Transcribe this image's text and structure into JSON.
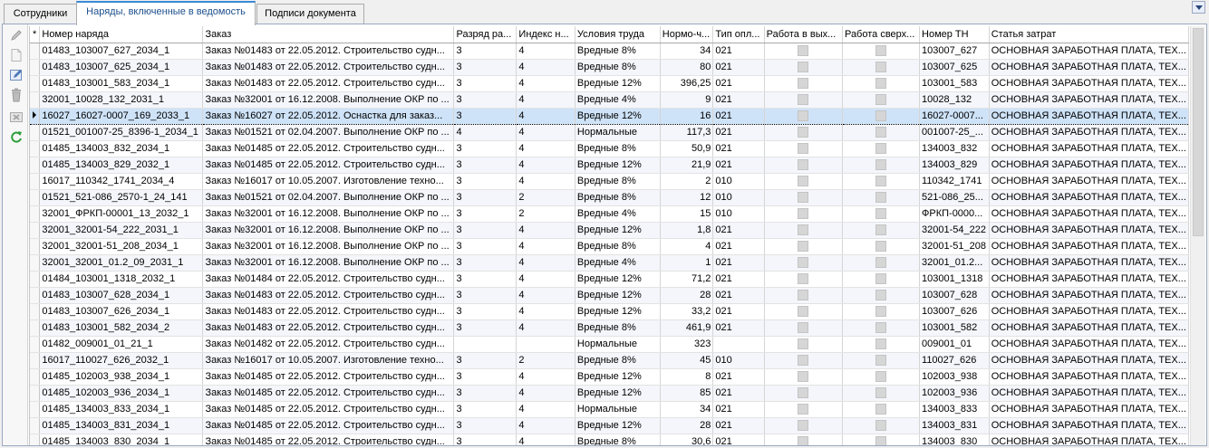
{
  "tabs": [
    {
      "label": "Сотрудники"
    },
    {
      "label": "Наряды, включенные в ведомость"
    },
    {
      "label": "Подписи документа"
    }
  ],
  "icons": [
    "pen-icon",
    "new-document-icon",
    "edit-icon",
    "delete-icon",
    "cancel-icon",
    "refresh-icon"
  ],
  "grid": {
    "header_marker": "*",
    "columns": [
      {
        "label": "Номер наряда"
      },
      {
        "label": "Заказ"
      },
      {
        "label": "Разряд ра..."
      },
      {
        "label": "Индекс н..."
      },
      {
        "label": "Условия труда"
      },
      {
        "label": "Нормо-ч..."
      },
      {
        "label": "Тип опл..."
      },
      {
        "label": "Работа в вых..."
      },
      {
        "label": "Работа сверх..."
      },
      {
        "label": "Номер ТН"
      },
      {
        "label": "Статья затрат"
      }
    ],
    "rows": [
      {
        "c": [
          "01483_103007_627_2034_1",
          "Заказ №01483 от 22.05.2012. Строительство судн...",
          "3",
          "4",
          "Вредные 8%",
          "34",
          "021",
          "103007_627",
          "ОСНОВНАЯ ЗАРАБОТНАЯ ПЛАТА, ТЕХ..."
        ]
      },
      {
        "c": [
          "01483_103007_625_2034_1",
          "Заказ №01483 от 22.05.2012. Строительство судн...",
          "3",
          "4",
          "Вредные 8%",
          "80",
          "021",
          "103007_625",
          "ОСНОВНАЯ ЗАРАБОТНАЯ ПЛАТА, ТЕХ..."
        ]
      },
      {
        "c": [
          "01483_103001_583_2034_1",
          "Заказ №01483 от 22.05.2012. Строительство судн...",
          "3",
          "4",
          "Вредные 12%",
          "396,25",
          "021",
          "103001_583",
          "ОСНОВНАЯ ЗАРАБОТНАЯ ПЛАТА, ТЕХ..."
        ]
      },
      {
        "c": [
          "32001_10028_132_2031_1",
          "Заказ №32001 от 16.12.2008. Выполнение ОКР по ...",
          "3",
          "4",
          "Вредные 4%",
          "9",
          "021",
          "10028_132",
          "ОСНОВНАЯ ЗАРАБОТНАЯ ПЛАТА, ТЕХ..."
        ]
      },
      {
        "c": [
          "16027_16027-0007_169_2033_1",
          "Заказ №16027 от 22.05.2012. Оснастка для заказ...",
          "3",
          "4",
          "Вредные 12%",
          "16",
          "021",
          "16027-0007...",
          "ОСНОВНАЯ ЗАРАБОТНАЯ ПЛАТА, ТЕХ..."
        ],
        "selected": true
      },
      {
        "c": [
          "01521_001007-25_8396-1_2034_1",
          "Заказ №01521 от 02.04.2007. Выполнение ОКР по ...",
          "4",
          "4",
          "Нормальные",
          "117,3",
          "021",
          "001007-25_...",
          "ОСНОВНАЯ ЗАРАБОТНАЯ ПЛАТА, ТЕХ..."
        ]
      },
      {
        "c": [
          "01485_134003_832_2034_1",
          "Заказ №01485 от 22.05.2012. Строительство судн...",
          "3",
          "4",
          "Вредные 8%",
          "50,9",
          "021",
          "134003_832",
          "ОСНОВНАЯ ЗАРАБОТНАЯ ПЛАТА, ТЕХ..."
        ]
      },
      {
        "c": [
          "01485_134003_829_2032_1",
          "Заказ №01485 от 22.05.2012. Строительство судн...",
          "3",
          "4",
          "Вредные 12%",
          "21,9",
          "021",
          "134003_829",
          "ОСНОВНАЯ ЗАРАБОТНАЯ ПЛАТА, ТЕХ..."
        ]
      },
      {
        "c": [
          "16017_110342_1741_2034_4",
          "Заказ №16017 от 10.05.2007. Изготовление техно...",
          "3",
          "4",
          "Вредные 8%",
          "2",
          "010",
          "110342_1741",
          "ОСНОВНАЯ ЗАРАБОТНАЯ ПЛАТА, ТЕХ..."
        ]
      },
      {
        "c": [
          "01521_521-086_2570-1_24_141",
          "Заказ №01521 от 02.04.2007. Выполнение ОКР по ...",
          "3",
          "2",
          "Вредные 8%",
          "12",
          "010",
          "521-086_25...",
          "ОСНОВНАЯ ЗАРАБОТНАЯ ПЛАТА, ТЕХ..."
        ]
      },
      {
        "c": [
          "32001_ФРКП-00001_13_2032_1",
          "Заказ №32001 от 16.12.2008. Выполнение ОКР по ...",
          "3",
          "2",
          "Вредные 4%",
          "15",
          "010",
          "ФРКП-0000...",
          "ОСНОВНАЯ ЗАРАБОТНАЯ ПЛАТА, ТЕХ..."
        ]
      },
      {
        "c": [
          "32001_32001-54_222_2031_1",
          "Заказ №32001 от 16.12.2008. Выполнение ОКР по ...",
          "3",
          "4",
          "Вредные 12%",
          "1,8",
          "021",
          "32001-54_222",
          "ОСНОВНАЯ ЗАРАБОТНАЯ ПЛАТА, ТЕХ..."
        ]
      },
      {
        "c": [
          "32001_32001-51_208_2034_1",
          "Заказ №32001 от 16.12.2008. Выполнение ОКР по ...",
          "3",
          "4",
          "Вредные 8%",
          "4",
          "021",
          "32001-51_208",
          "ОСНОВНАЯ ЗАРАБОТНАЯ ПЛАТА, ТЕХ..."
        ]
      },
      {
        "c": [
          "32001_32001_01.2_09_2031_1",
          "Заказ №32001 от 16.12.2008. Выполнение ОКР по ...",
          "3",
          "4",
          "Вредные 4%",
          "1",
          "021",
          "32001_01.2...",
          "ОСНОВНАЯ ЗАРАБОТНАЯ ПЛАТА, ТЕХ..."
        ]
      },
      {
        "c": [
          "01484_103001_1318_2032_1",
          "Заказ №01484 от 22.05.2012. Строительство судн...",
          "3",
          "4",
          "Вредные 12%",
          "71,2",
          "021",
          "103001_1318",
          "ОСНОВНАЯ ЗАРАБОТНАЯ ПЛАТА, ТЕХ..."
        ]
      },
      {
        "c": [
          "01483_103007_628_2034_1",
          "Заказ №01483 от 22.05.2012. Строительство судн...",
          "3",
          "4",
          "Вредные 12%",
          "28",
          "021",
          "103007_628",
          "ОСНОВНАЯ ЗАРАБОТНАЯ ПЛАТА, ТЕХ..."
        ]
      },
      {
        "c": [
          "01483_103007_626_2034_1",
          "Заказ №01483 от 22.05.2012. Строительство судн...",
          "3",
          "4",
          "Вредные 12%",
          "33,2",
          "021",
          "103007_626",
          "ОСНОВНАЯ ЗАРАБОТНАЯ ПЛАТА, ТЕХ..."
        ]
      },
      {
        "c": [
          "01483_103001_582_2034_2",
          "Заказ №01483 от 22.05.2012. Строительство судн...",
          "3",
          "4",
          "Вредные 8%",
          "461,9",
          "021",
          "103001_582",
          "ОСНОВНАЯ ЗАРАБОТНАЯ ПЛАТА, ТЕХ..."
        ]
      },
      {
        "c": [
          "01482_009001_01_21_1",
          "Заказ №01482 от 22.05.2012. Строительство судн...",
          "",
          "",
          "Нормальные",
          "323",
          "",
          "009001_01",
          "ОСНОВНАЯ ЗАРАБОТНАЯ ПЛАТА, ТЕХ..."
        ]
      },
      {
        "c": [
          "16017_110027_626_2032_1",
          "Заказ №16017 от 10.05.2007. Изготовление техно...",
          "3",
          "2",
          "Вредные 8%",
          "45",
          "010",
          "110027_626",
          "ОСНОВНАЯ ЗАРАБОТНАЯ ПЛАТА, ТЕХ..."
        ]
      },
      {
        "c": [
          "01485_102003_938_2034_1",
          "Заказ №01485 от 22.05.2012. Строительство судн...",
          "3",
          "4",
          "Вредные 12%",
          "8",
          "021",
          "102003_938",
          "ОСНОВНАЯ ЗАРАБОТНАЯ ПЛАТА, ТЕХ..."
        ]
      },
      {
        "c": [
          "01485_102003_936_2034_1",
          "Заказ №01485 от 22.05.2012. Строительство судн...",
          "3",
          "4",
          "Вредные 12%",
          "85",
          "021",
          "102003_936",
          "ОСНОВНАЯ ЗАРАБОТНАЯ ПЛАТА, ТЕХ..."
        ]
      },
      {
        "c": [
          "01485_134003_833_2034_1",
          "Заказ №01485 от 22.05.2012. Строительство судн...",
          "3",
          "4",
          "Нормальные",
          "34",
          "021",
          "134003_833",
          "ОСНОВНАЯ ЗАРАБОТНАЯ ПЛАТА, ТЕХ..."
        ]
      },
      {
        "c": [
          "01485_134003_831_2034_1",
          "Заказ №01485 от 22.05.2012. Строительство судн...",
          "3",
          "4",
          "Вредные 12%",
          "28",
          "021",
          "134003_831",
          "ОСНОВНАЯ ЗАРАБОТНАЯ ПЛАТА, ТЕХ..."
        ]
      },
      {
        "c": [
          "01485_134003_830_2034_1",
          "Заказ №01485 от 22.05.2012. Строительство судн...",
          "3",
          "4",
          "Вредные 8%",
          "30,6",
          "021",
          "134003_830",
          "ОСНОВНАЯ ЗАРАБОТНАЯ ПЛАТА, ТЕХ..."
        ]
      }
    ]
  }
}
